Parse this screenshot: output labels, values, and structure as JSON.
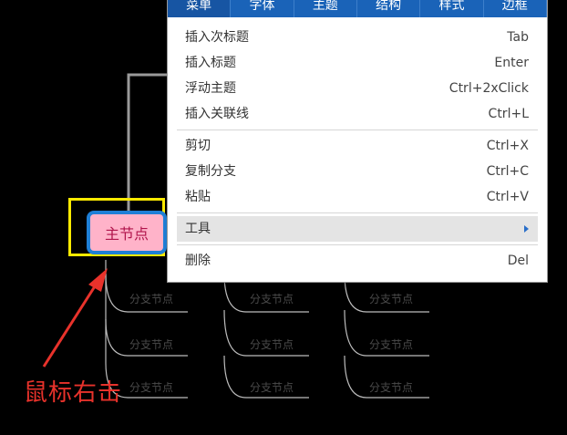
{
  "menu": {
    "tabs": [
      {
        "label": "菜单",
        "active": true
      },
      {
        "label": "字体",
        "active": false
      },
      {
        "label": "主题",
        "active": false
      },
      {
        "label": "结构",
        "active": false
      },
      {
        "label": "样式",
        "active": false
      },
      {
        "label": "边框",
        "active": false
      }
    ],
    "items": [
      {
        "label": "插入次标题",
        "shortcut": "Tab"
      },
      {
        "label": "插入标题",
        "shortcut": "Enter"
      },
      {
        "label": "浮动主题",
        "shortcut": "Ctrl+2xClick"
      },
      {
        "label": "插入关联线",
        "shortcut": "Ctrl+L"
      },
      {
        "label": "剪切",
        "shortcut": "Ctrl+X"
      },
      {
        "label": "复制分支",
        "shortcut": "Ctrl+C"
      },
      {
        "label": "粘贴",
        "shortcut": "Ctrl+V"
      },
      {
        "label": "工具",
        "shortcut": ""
      },
      {
        "label": "删除",
        "shortcut": "Del"
      }
    ]
  },
  "main_node": {
    "label": "主节点"
  },
  "sub_nodes": [
    {
      "label": "分支节点"
    },
    {
      "label": "分支节点"
    },
    {
      "label": "分支节点"
    },
    {
      "label": "分支节点"
    },
    {
      "label": "分支节点"
    },
    {
      "label": "分支节点"
    },
    {
      "label": "分支节点"
    },
    {
      "label": "分支节点"
    },
    {
      "label": "分支节点"
    }
  ],
  "annotation": {
    "text": "鼠标右击"
  },
  "colors": {
    "menu_tab_bg": "#1a63b8",
    "node_fill": "#ffb3c9",
    "node_border": "#1f7fd6",
    "highlight_border": "#ffea00",
    "annotation": "#e8322b"
  }
}
